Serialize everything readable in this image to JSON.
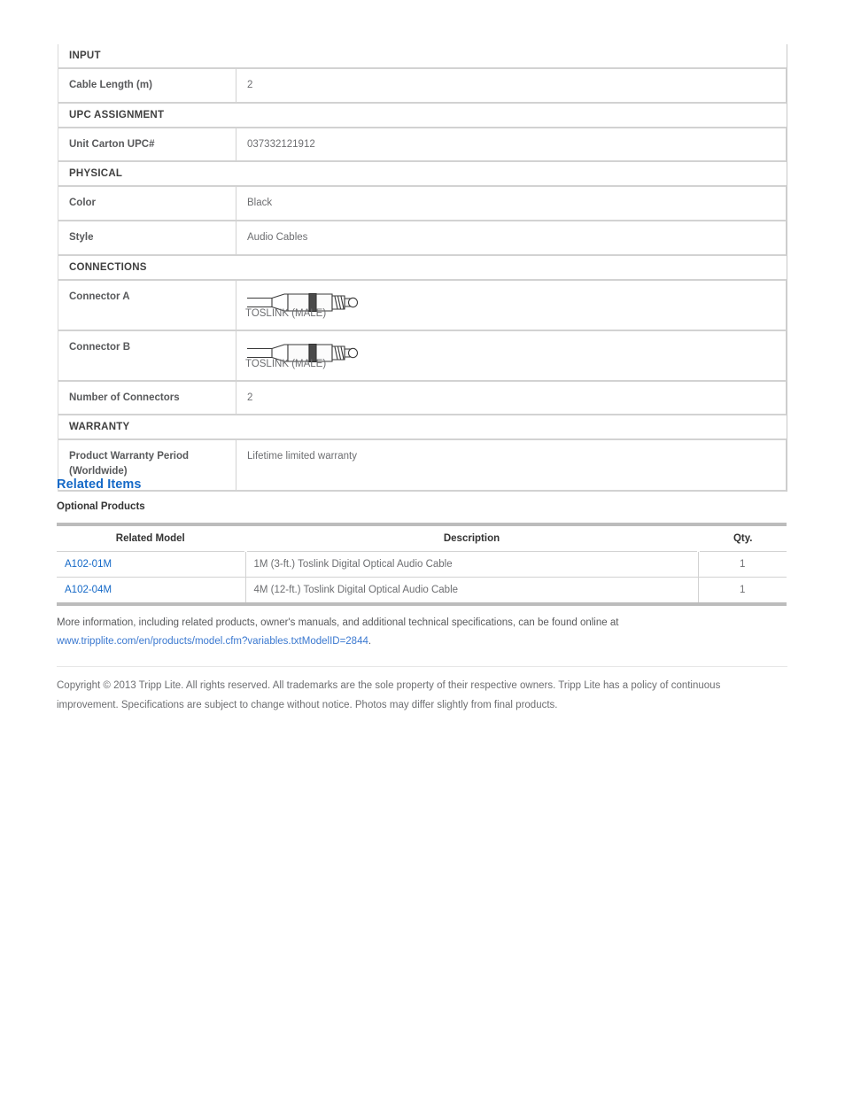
{
  "spec_table": {
    "rows": [
      {
        "kind": "section",
        "title": "INPUT"
      },
      {
        "kind": "field",
        "label": "Cable Length (m)",
        "value": "2"
      },
      {
        "kind": "section",
        "title": "UPC ASSIGNMENT"
      },
      {
        "kind": "field",
        "label": "Unit Carton UPC#",
        "value": "037332121912"
      },
      {
        "kind": "section",
        "title": "PHYSICAL"
      },
      {
        "kind": "field",
        "label": "Color",
        "value": "Black"
      },
      {
        "kind": "field",
        "label": "Style",
        "value": "Audio Cables"
      },
      {
        "kind": "section",
        "title": "CONNECTIONS"
      },
      {
        "kind": "connector",
        "label": "Connector A",
        "caption": "TOSLINK (MALE)",
        "icon": "toslink-male-connector-icon"
      },
      {
        "kind": "connector",
        "label": "Connector B",
        "caption": "TOSLINK (MALE)",
        "icon": "toslink-male-connector-icon"
      },
      {
        "kind": "field",
        "label": "Number of Connectors",
        "value": "2"
      },
      {
        "kind": "section",
        "title": "WARRANTY"
      },
      {
        "kind": "field",
        "label": "Product Warranty Period (Worldwide)",
        "value": "Lifetime limited warranty"
      }
    ]
  },
  "related": {
    "heading": "Related Items",
    "subheading": "Optional Products",
    "columns": [
      "Related Model",
      "Description",
      "Qty."
    ],
    "rows": [
      {
        "model": "A102-01M",
        "description": "1M (3-ft.) Toslink Digital Optical Audio Cable",
        "qty": "1"
      },
      {
        "model": "A102-04M",
        "description": "4M (12-ft.) Toslink Digital Optical Audio Cable",
        "qty": "1"
      }
    ]
  },
  "info": {
    "text": "More information, including related products, owner's manuals, and additional technical specifications, can be found online at",
    "link_text": "www.tripplite.com/en/products/model.cfm?variables.txtModelID=2844",
    "link_suffix": "."
  },
  "copyright": {
    "text": "Copyright © 2013 Tripp Lite. All rights reserved. All trademarks are the sole property of their respective owners. Tripp Lite has a policy of continuous improvement. Specifications are subject to change without notice. Photos may differ slightly from final products."
  },
  "colors": {
    "link": "#1569c7",
    "heading": "#1569c7",
    "label_text": "#58595b",
    "value_text": "#6d6e71",
    "border": "#d2d2d2",
    "table_rule": "#bcbcbc"
  }
}
